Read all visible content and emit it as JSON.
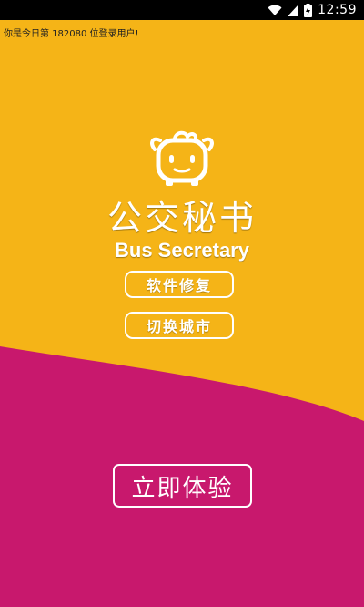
{
  "status_bar": {
    "time": "12:59",
    "icons": [
      "wifi-icon",
      "signal-icon",
      "battery-icon"
    ]
  },
  "login_count_text": "你是今日第 182080 位登录用户!",
  "logo": {
    "icon": "bus-mascot-icon",
    "title": "公交秘书",
    "subtitle": "Bus Secretary"
  },
  "buttons": {
    "repair": "软件修复",
    "switch_city": "切换城市",
    "experience": "立即体验"
  },
  "colors": {
    "background_top": "#F5B417",
    "background_bottom": "#C8186D",
    "text": "#FFFFFF"
  }
}
